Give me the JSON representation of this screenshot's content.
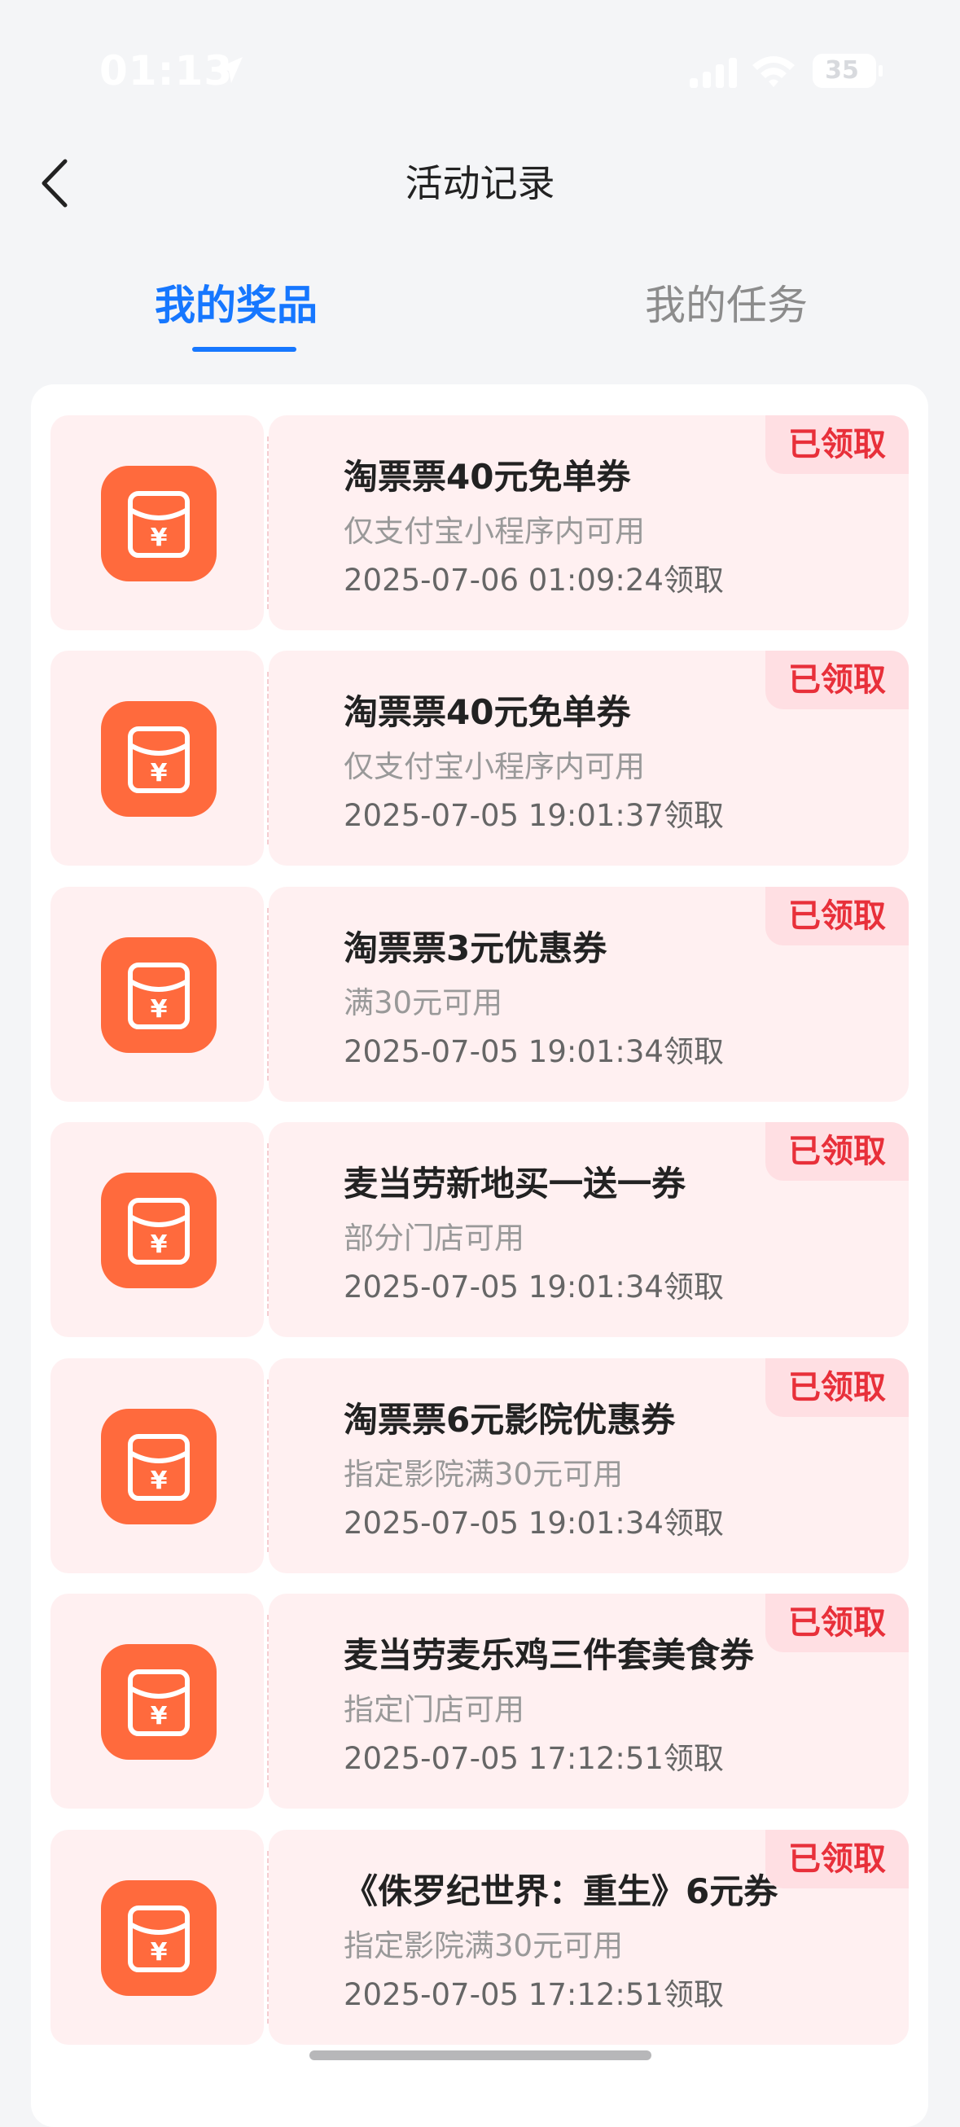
{
  "status_bar": {
    "time": "01:13",
    "battery": "35"
  },
  "header": {
    "title": "活动记录"
  },
  "tabs": [
    {
      "label": "我的奖品",
      "active": true
    },
    {
      "label": "我的任务",
      "active": false
    }
  ],
  "colors": {
    "accent": "#1677ff",
    "icon_bg": "#ff6a3d",
    "badge_text": "#e8303a",
    "card_bg": "#fff0f1"
  },
  "prizes": [
    {
      "title": "淘票票40元免单券",
      "condition": "仅支付宝小程序内可用",
      "claimed_at": "2025-07-06 01:09:24领取",
      "status": "已领取",
      "icon": "red-envelope-yuan-icon"
    },
    {
      "title": "淘票票40元免单券",
      "condition": "仅支付宝小程序内可用",
      "claimed_at": "2025-07-05 19:01:37领取",
      "status": "已领取",
      "icon": "red-envelope-yuan-icon"
    },
    {
      "title": "淘票票3元优惠券",
      "condition": "满30元可用",
      "claimed_at": "2025-07-05 19:01:34领取",
      "status": "已领取",
      "icon": "red-envelope-yuan-icon"
    },
    {
      "title": "麦当劳新地买一送一券",
      "condition": "部分门店可用",
      "claimed_at": "2025-07-05 19:01:34领取",
      "status": "已领取",
      "icon": "red-envelope-yuan-icon"
    },
    {
      "title": "淘票票6元影院优惠券",
      "condition": "指定影院满30元可用",
      "claimed_at": "2025-07-05 19:01:34领取",
      "status": "已领取",
      "icon": "red-envelope-yuan-icon"
    },
    {
      "title": "麦当劳麦乐鸡三件套美食券",
      "condition": "指定门店可用",
      "claimed_at": "2025-07-05 17:12:51领取",
      "status": "已领取",
      "icon": "red-envelope-yuan-icon"
    },
    {
      "title": "《侏罗纪世界：重生》6元券",
      "condition": "指定影院满30元可用",
      "claimed_at": "2025-07-05 17:12:51领取",
      "status": "已领取",
      "icon": "red-envelope-yuan-icon"
    }
  ]
}
